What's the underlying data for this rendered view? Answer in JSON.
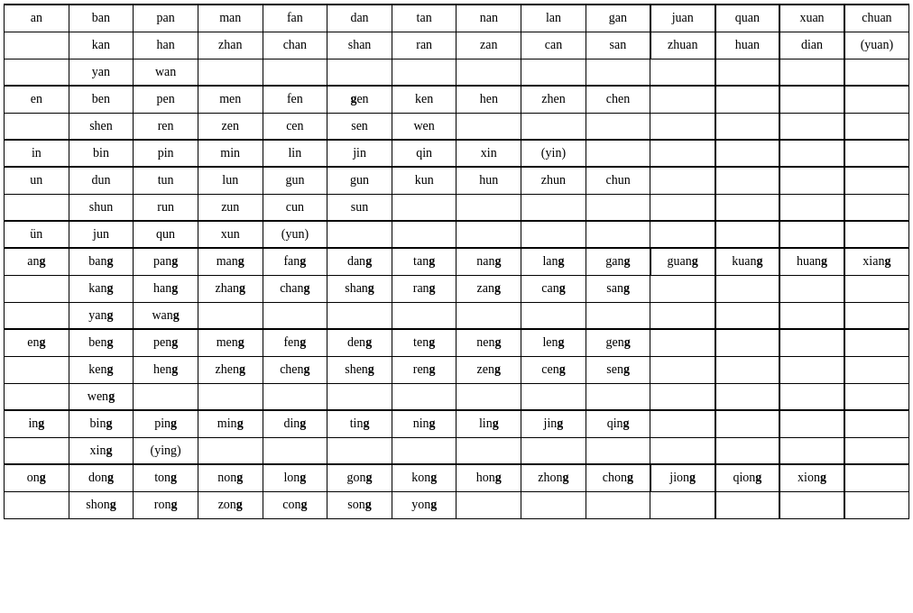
{
  "table": {
    "rows": [
      [
        "an",
        "ban",
        "pan",
        "man",
        "fan",
        "dan",
        "tan",
        "nan",
        "lan",
        "gan",
        "juan",
        "quan",
        "xuan",
        "chuan"
      ],
      [
        "",
        "kan",
        "han",
        "zhan",
        "chan",
        "shan",
        "ran",
        "zan",
        "can",
        "san",
        "zhuan",
        "huan",
        "dian",
        "(yuan)"
      ],
      [
        "",
        "yan",
        "wan",
        "",
        "",
        "",
        "",
        "",
        "",
        "",
        "",
        "",
        "",
        ""
      ],
      [
        "en",
        "ben",
        "pen",
        "men",
        "fen",
        "gen",
        "ken",
        "hen",
        "zhen",
        "chen",
        "",
        "",
        "",
        ""
      ],
      [
        "",
        "shen",
        "ren",
        "zen",
        "cen",
        "sen",
        "wen",
        "",
        "",
        "",
        "",
        "",
        "",
        ""
      ],
      [
        "in",
        "bin",
        "pin",
        "min",
        "lin",
        "jin",
        "qin",
        "xin",
        "(yin)",
        "",
        "",
        "",
        "",
        ""
      ],
      [
        "un",
        "dun",
        "tun",
        "lun",
        "gun",
        "gun",
        "kun",
        "hun",
        "zhun",
        "chun",
        "",
        "",
        "",
        ""
      ],
      [
        "",
        "shun",
        "run",
        "zun",
        "cun",
        "sun",
        "",
        "",
        "",
        "",
        "",
        "",
        "",
        ""
      ],
      [
        "ün",
        "jun",
        "qun",
        "xun",
        "(yun)",
        "",
        "",
        "",
        "",
        "",
        "",
        "",
        "",
        ""
      ],
      [
        "ang",
        "bang",
        "pang",
        "mang",
        "fang",
        "dang",
        "tang",
        "nang",
        "lang",
        "gang",
        "guang",
        "kuang",
        "huang",
        "xiang"
      ],
      [
        "",
        "kang",
        "hang",
        "zhang",
        "chang",
        "shang",
        "rang",
        "zang",
        "cang",
        "sang",
        "",
        "",
        "",
        ""
      ],
      [
        "",
        "yang",
        "wang",
        "",
        "",
        "",
        "",
        "",
        "",
        "",
        "",
        "",
        "",
        ""
      ],
      [
        "eng",
        "beng",
        "peng",
        "meng",
        "feng",
        "deng",
        "teng",
        "neng",
        "leng",
        "geng",
        "",
        "",
        "",
        ""
      ],
      [
        "",
        "keng",
        "heng",
        "zheng",
        "cheng",
        "sheng",
        "reng",
        "zeng",
        "ceng",
        "seng",
        "",
        "",
        "",
        ""
      ],
      [
        "",
        "weng",
        "",
        "",
        "",
        "",
        "",
        "",
        "",
        "",
        "",
        "",
        "",
        ""
      ],
      [
        "ing",
        "bing",
        "ping",
        "ming",
        "ding",
        "ting",
        "ning",
        "ling",
        "jing",
        "qing",
        "",
        "",
        "",
        ""
      ],
      [
        "",
        "xing",
        "(ying)",
        "",
        "",
        "",
        "",
        "",
        "",
        "",
        "",
        "",
        "",
        ""
      ],
      [
        "ong",
        "dong",
        "tong",
        "nong",
        "long",
        "gong",
        "kong",
        "hong",
        "zhong",
        "chong",
        "jiong",
        "qiong",
        "xiong",
        ""
      ],
      [
        "",
        "shong",
        "rong",
        "zong",
        "cong",
        "song",
        "yong",
        "",
        "",
        "",
        "",
        "",
        "",
        ""
      ]
    ],
    "bold_g_cells": {
      "gen_g": true
    }
  }
}
